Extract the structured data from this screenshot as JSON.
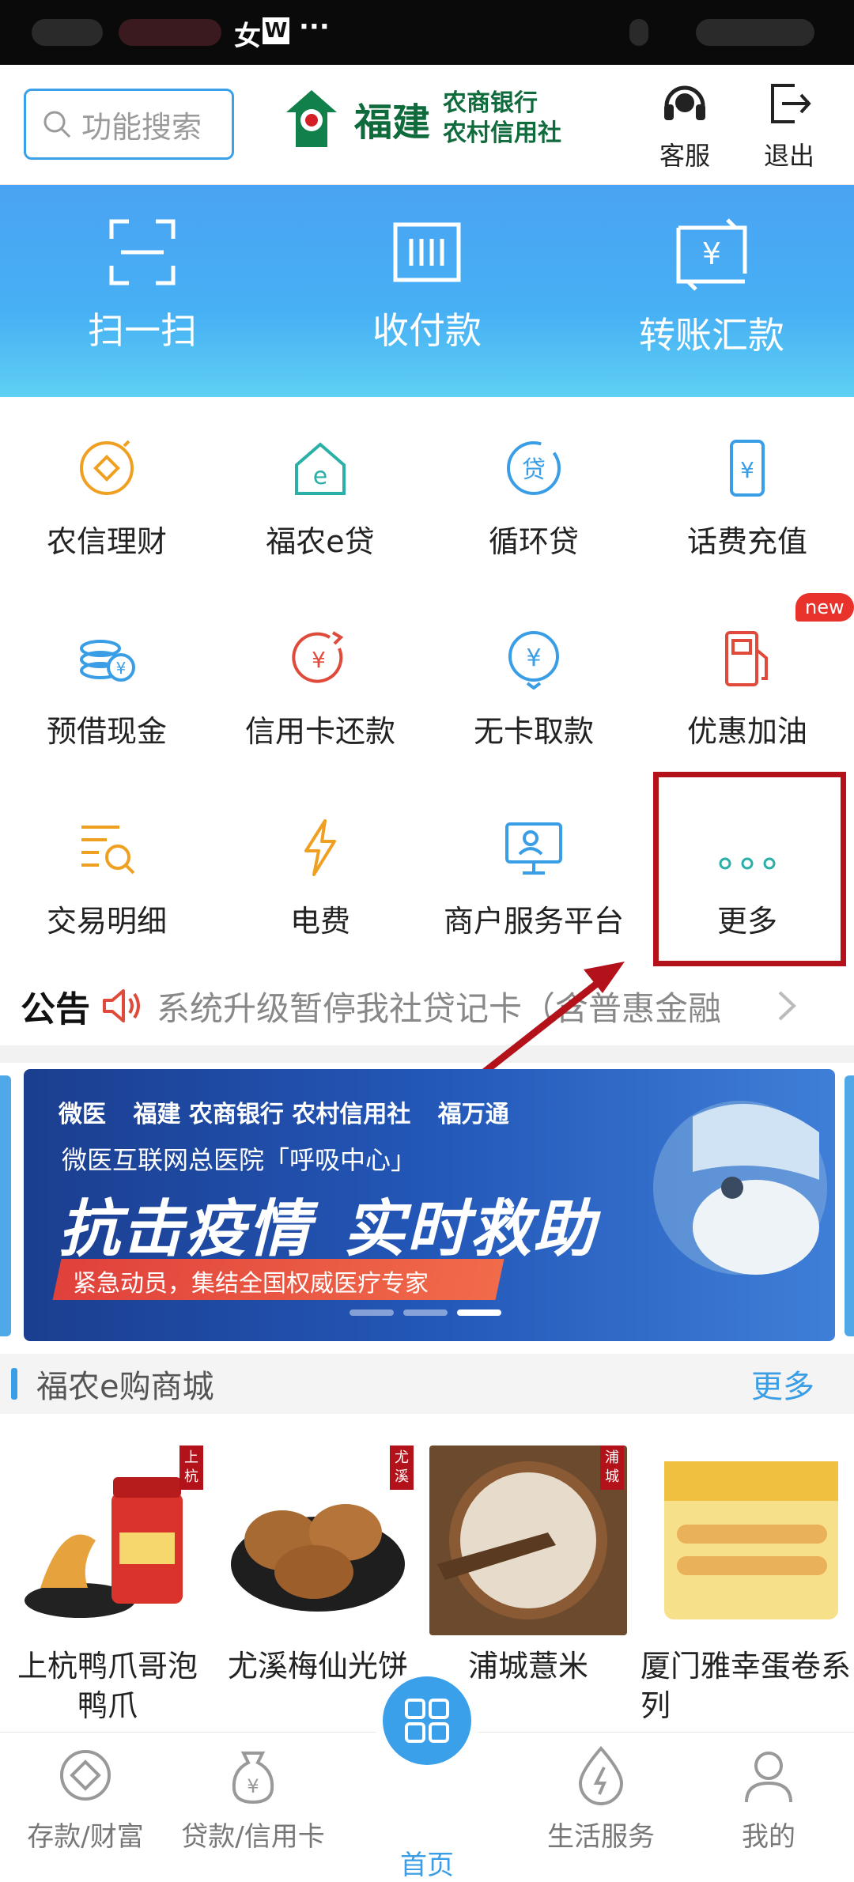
{
  "status_bar": {
    "glyph1": "女",
    "w_badge": "W",
    "dots": "···"
  },
  "header": {
    "search_placeholder": "功能搜索",
    "bank_name_big": "福建",
    "bank_name_line1": "农商银行",
    "bank_name_line2": "农村信用社",
    "service_label": "客服",
    "logout_label": "退出"
  },
  "banner": {
    "items": [
      {
        "label": "扫一扫",
        "icon": "scan-icon"
      },
      {
        "label": "收付款",
        "icon": "barcode-icon"
      },
      {
        "label": "转账汇款",
        "icon": "transfer-icon"
      }
    ]
  },
  "grid": {
    "items": [
      {
        "label": "农信理财",
        "icon": "wealth-coin-icon"
      },
      {
        "label": "福农e贷",
        "icon": "e-loan-house-icon"
      },
      {
        "label": "循环贷",
        "icon": "loan-circle-icon"
      },
      {
        "label": "话费充值",
        "icon": "phone-recharge-icon"
      },
      {
        "label": "预借现金",
        "icon": "coins-icon"
      },
      {
        "label": "信用卡还款",
        "icon": "card-repay-icon"
      },
      {
        "label": "无卡取款",
        "icon": "cardless-withdraw-icon"
      },
      {
        "label": "优惠加油",
        "icon": "fuel-pump-icon"
      },
      {
        "label": "交易明细",
        "icon": "transaction-search-icon"
      },
      {
        "label": "电费",
        "icon": "lightning-icon"
      },
      {
        "label": "商户服务平台",
        "icon": "merchant-monitor-icon"
      },
      {
        "label": "更多",
        "icon": "more-dots-icon"
      }
    ],
    "new_badge": "new"
  },
  "notice": {
    "title": "公告",
    "text": "系统升级暂停我社贷记卡（含普惠金融"
  },
  "promo": {
    "brand_wedoctor": "微医",
    "brand_bank": "福建 农商银行 农村信用社",
    "brand_fwt": "福万通",
    "subtitle": "微医互联网总医院「呼吸中心」",
    "headline_1": "抗击疫情",
    "headline_2": "实时救助",
    "strip_text": "紧急动员，集结全国权威医疗专家"
  },
  "mall": {
    "title": "福农e购商城",
    "more": "更多",
    "products": [
      {
        "name": "上杭鸭爪哥泡鸭爪",
        "tag": "上杭",
        "color": "#d9332b"
      },
      {
        "name": "尤溪梅仙光饼",
        "tag": "尤溪",
        "color": "#a76a32"
      },
      {
        "name": "浦城薏米",
        "tag": "浦城",
        "color": "#c9a27a"
      },
      {
        "name": "厦门雅幸蛋卷系列",
        "tag": "",
        "color": "#f0c040"
      }
    ]
  },
  "tabbar": {
    "tabs": [
      {
        "label": "存款/财富",
        "icon": "wealth-tab-icon"
      },
      {
        "label": "贷款/信用卡",
        "icon": "loan-bag-icon"
      },
      {
        "label": "首页",
        "icon": "home-grid-icon"
      },
      {
        "label": "生活服务",
        "icon": "life-service-icon"
      },
      {
        "label": "我的",
        "icon": "profile-icon"
      }
    ]
  },
  "colors": {
    "accent": "#3a9ee6",
    "brand_green": "#0f6b3c",
    "highlight_red": "#b3121b",
    "icon_orange": "#f0a020",
    "icon_teal": "#2ab0a6"
  }
}
